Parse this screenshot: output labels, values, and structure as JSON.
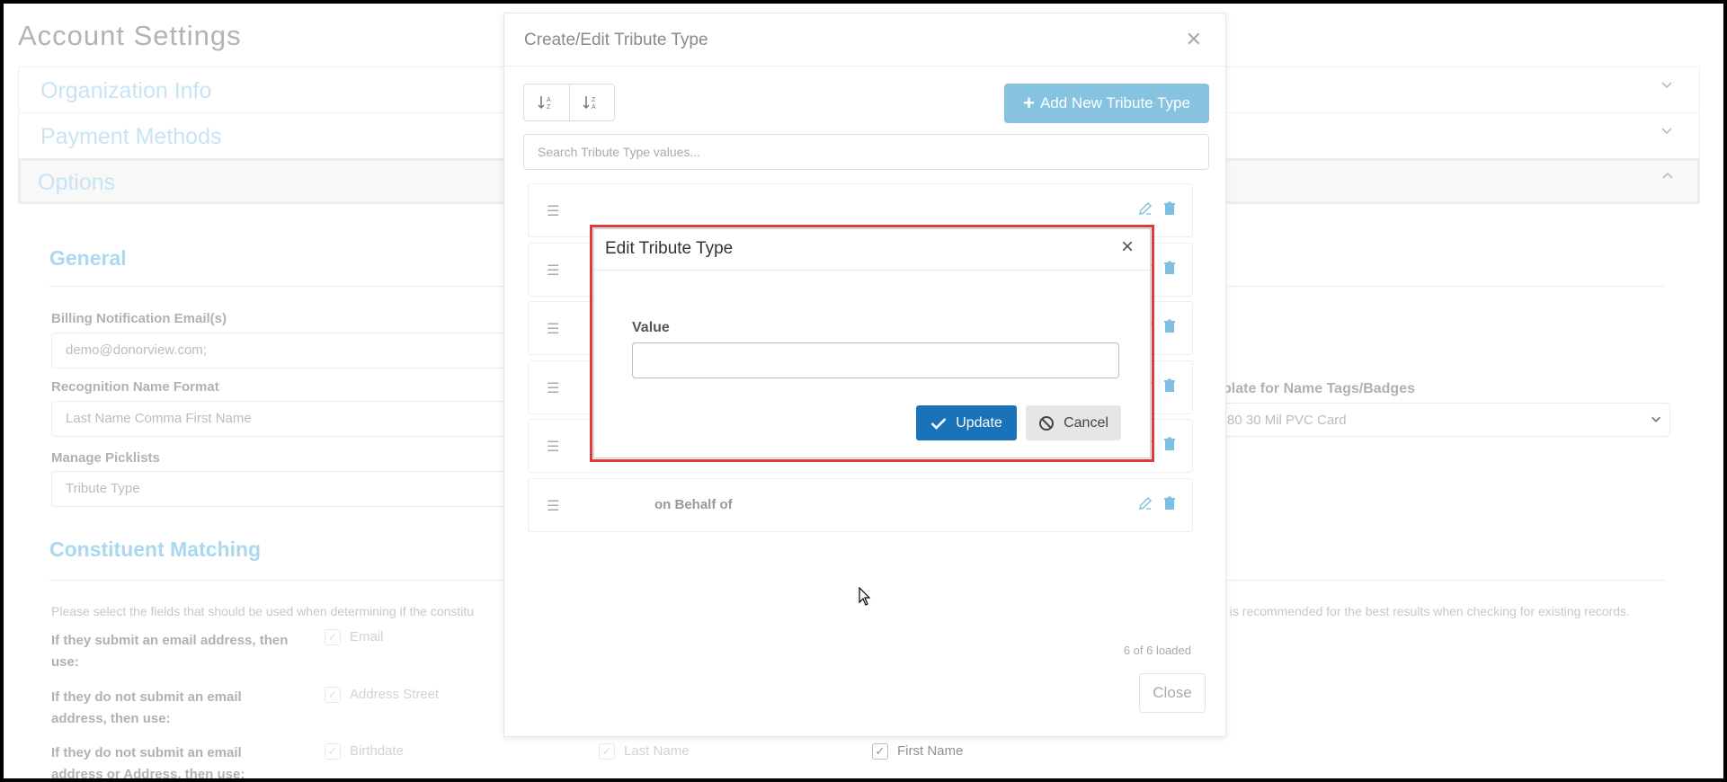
{
  "page": {
    "title": "Account Settings"
  },
  "accordion": [
    {
      "label": "Organization Info"
    },
    {
      "label": "Payment Methods"
    },
    {
      "label": "Options"
    }
  ],
  "general": {
    "heading": "General",
    "billing_label": "Billing Notification Email(s)",
    "billing_value": "demo@donorview.com;",
    "recognition_label": "Recognition Name Format",
    "recognition_value": "Last Name Comma First Name",
    "picklists_label": "Manage Picklists",
    "picklists_value": "Tribute Type",
    "template_label": "plate for Name Tags/Badges",
    "template_value": "80 30 Mil PVC Card"
  },
  "constituent": {
    "heading": "Constituent Matching",
    "desc_start": "Please select the fields that should be used when determining if the constitu",
    "desc_end": "ld is recommended for the best results when checking for existing records.",
    "rows": [
      {
        "label": "If they submit an email address, then use:"
      },
      {
        "label": "If they do not submit an email address, then use:"
      },
      {
        "label": "If they do not submit an email address or Address, then use:"
      }
    ],
    "checkboxes": {
      "email": "Email",
      "address_street": "Address Street",
      "birthdate": "Birthdate",
      "last_name": "Last Name",
      "first_name": "First Name"
    }
  },
  "modal": {
    "title": "Create/Edit Tribute Type",
    "add_label": "Add New Tribute Type",
    "search_placeholder": "Search Tribute Type values...",
    "rows": [
      "",
      "",
      "",
      "",
      "",
      "on Behalf of"
    ],
    "loaded": "6 of 6 loaded",
    "close_label": "Close"
  },
  "edit_dialog": {
    "title": "Edit Tribute Type",
    "value_label": "Value",
    "value": "",
    "update_label": "Update",
    "cancel_label": "Cancel"
  }
}
